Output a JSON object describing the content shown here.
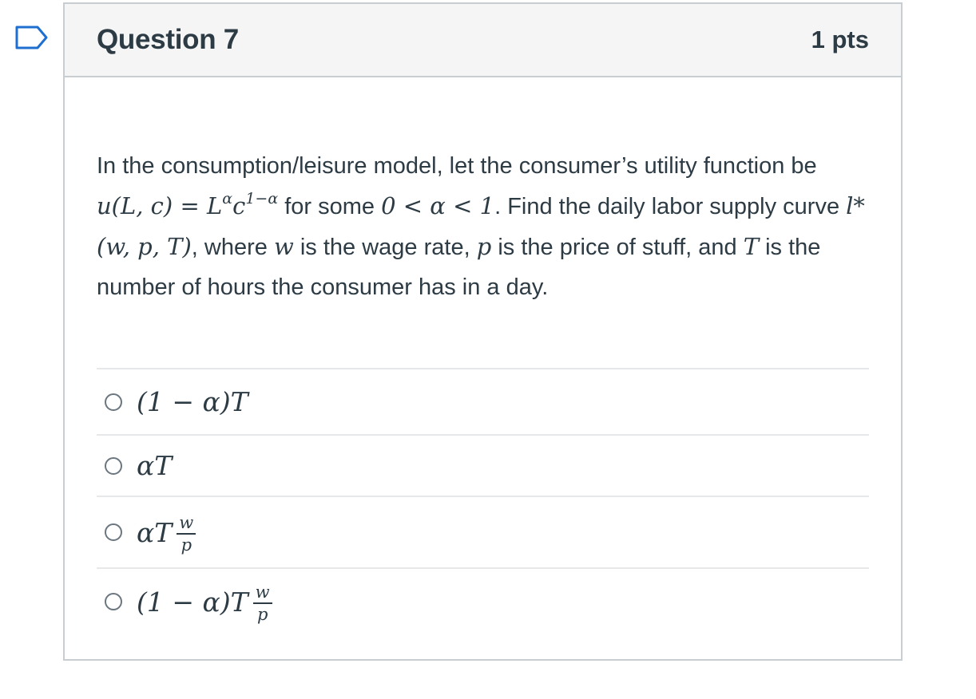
{
  "question": {
    "title": "Question 7",
    "points": "1 pts",
    "prompt": {
      "t1": "In the consumption/leisure model, let the consumer’s utility function be ",
      "utility_lhs": "u(L, c) = L",
      "exp_alpha": "α",
      "utility_c": "c",
      "exp_one_minus_alpha": "1−α",
      "t2": " for some ",
      "alpha_range": "0 < α < 1",
      "t3": ". Find the daily labor supply curve ",
      "l_star": "l*",
      "args": "(w, p, T)",
      "t4": ", where ",
      "w": "w",
      "t5": " is the wage rate, ",
      "p": "p",
      "t6": " is the price of stuff, and ",
      "T": "T",
      "t7": " is the number of hours the consumer has in a day."
    },
    "answers": [
      {
        "expr": "(1 − α)T"
      },
      {
        "expr": "αT"
      },
      {
        "expr": "αT",
        "frac_num": "w",
        "frac_den": "p"
      },
      {
        "expr": "(1 − α)T",
        "frac_num": "w",
        "frac_den": "p"
      }
    ]
  },
  "colors": {
    "flag_border": "#1f6fd1",
    "text": "#2d3b45",
    "header_bg": "#f5f5f5",
    "border": "#c7cdd1"
  },
  "icons": {
    "flag": "bookmark-flag-icon",
    "radio": "radio-unchecked-icon"
  }
}
